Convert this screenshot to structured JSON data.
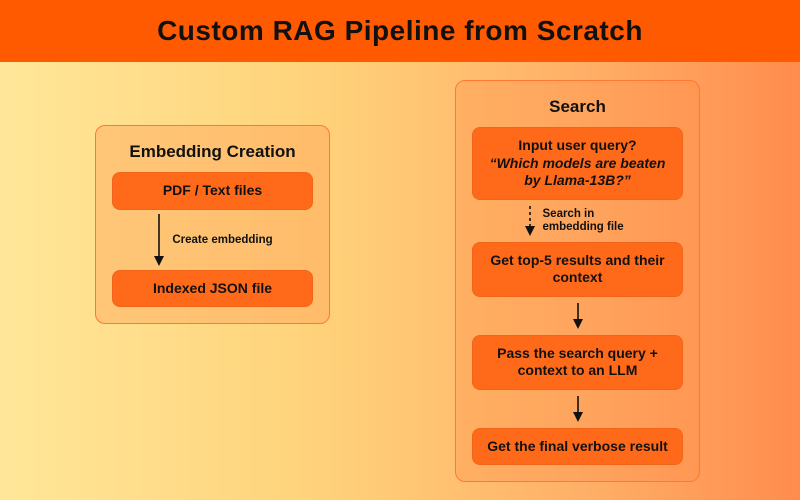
{
  "title": "Custom RAG Pipeline from Scratch",
  "embedding_panel": {
    "title": "Embedding Creation",
    "node_input": "PDF / Text files",
    "arrow_label": "Create embedding",
    "node_output": "Indexed JSON file"
  },
  "search_panel": {
    "title": "Search",
    "node_query_line1": "Input user query?",
    "node_query_line2": "“Which models are beaten by Llama-13B?”",
    "arrow1_label": "Search in embedding file",
    "node_top5": "Get top-5 results and their context",
    "node_pass": "Pass the search query + context to an LLM",
    "node_final": "Get the final verbose result"
  },
  "colors": {
    "brand_orange": "#ff5a00",
    "node_orange": "#ff6a1a"
  }
}
